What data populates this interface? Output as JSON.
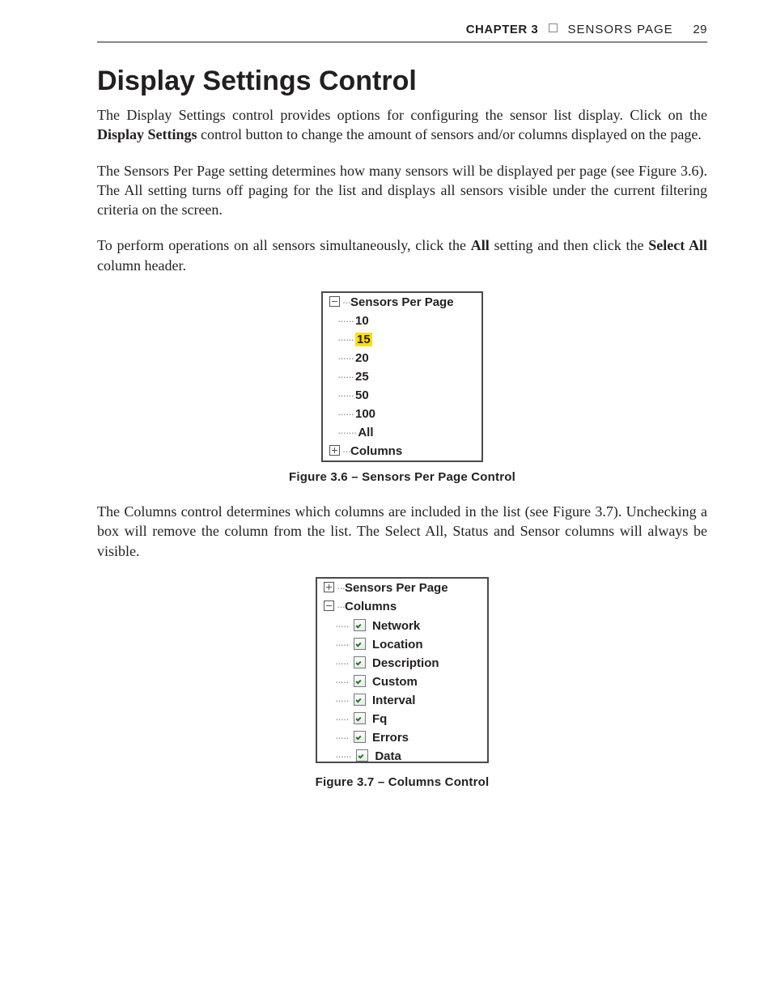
{
  "header": {
    "chapter": "CHAPTER 3",
    "section": "SENSORS PAGE",
    "page_number": "29"
  },
  "heading": "Display Settings Control",
  "para1_a": "The Display Settings control provides options for configuring the sensor list display. Click on the ",
  "para1_bold": "Display Settings",
  "para1_b": " control button to change the amount of sensors and/or columns displayed on the page.",
  "para2": "The Sensors Per Page setting determines how many sensors will be displayed per page (see Figure 3.6). The All setting turns off paging for the list and displays all sensors visible under the current filtering criteria on the screen.",
  "para3_a": "To perform operations on all sensors simultaneously, click the ",
  "para3_bold1": "All",
  "para3_b": " setting and then click the ",
  "para3_bold2": "Select All",
  "para3_c": " column header.",
  "tree1": {
    "root_open": "Sensors Per Page",
    "options": [
      "10",
      "15",
      "20",
      "25",
      "50",
      "100",
      "All"
    ],
    "selected": "15",
    "root_closed": "Columns"
  },
  "caption1": "Figure 3.6 – Sensors Per Page Control",
  "para4": "The Columns control determines which columns are included in the list (see Figure 3.7). Unchecking a box will remove the column from the list. The Select All, Status and Sensor columns will always be visible.",
  "tree2": {
    "root_closed": "Sensors Per Page",
    "root_open": "Columns",
    "columns": [
      "Network",
      "Location",
      "Description",
      "Custom",
      "Interval",
      "Fq",
      "Errors",
      "Data"
    ]
  },
  "caption2": "Figure 3.7 – Columns Control",
  "chart_data": {
    "type": "table",
    "sensors_per_page_options": [
      10,
      15,
      20,
      25,
      50,
      100,
      "All"
    ],
    "sensors_per_page_selected": 15,
    "columns_checked": {
      "Network": true,
      "Location": true,
      "Description": true,
      "Custom": true,
      "Interval": true,
      "Fq": true,
      "Errors": true,
      "Data": true
    }
  }
}
